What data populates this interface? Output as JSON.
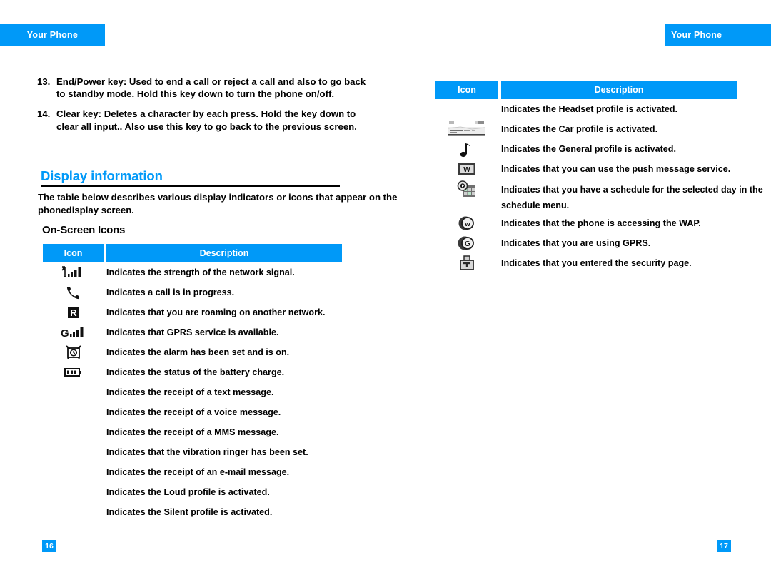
{
  "banners": {
    "left_label": "Your Phone",
    "right_label": "Your Phone"
  },
  "accent_color": "#0099F8",
  "left_page": {
    "numbered_list": [
      {
        "marker": "13.",
        "text": "End/Power key: Used to end a call or reject a call and also to go back to standby mode. Hold this key down to turn the phone on/off."
      },
      {
        "marker": "14.",
        "text": "Clear key: Deletes a character by each press. Hold the key down to clear all input.. Also use this key to go back to the previous screen."
      }
    ],
    "section_title": "Display information",
    "intro_part1": "The table below describes various display indicators or icons that appear on the phon",
    "intro_part2": "e",
    "intro_part3": " display screen.",
    "sub_heading": "On-Screen Icons",
    "table": {
      "headers": {
        "icon": "Icon",
        "description": "Description"
      },
      "rows": [
        {
          "icon_name": "signal-strength-icon",
          "description": "Indicates the strength of the network signal."
        },
        {
          "icon_name": "call-in-progress-icon",
          "description": "Indicates a call is in progress."
        },
        {
          "icon_name": "roaming-icon",
          "description": "Indicates that you are roaming on another network."
        },
        {
          "icon_name": "gprs-available-icon",
          "description": "Indicates that GPRS service is available."
        },
        {
          "icon_name": "alarm-clock-icon",
          "description": "Indicates the alarm has been set and is on."
        },
        {
          "icon_name": "battery-icon",
          "description": "Indicates the status of the battery charge."
        },
        {
          "icon_name": "text-message-icon",
          "description": "Indicates the receipt of a text message."
        },
        {
          "icon_name": "voice-message-icon",
          "description": "Indicates the receipt of a voice message."
        },
        {
          "icon_name": "mms-message-icon",
          "description": "Indicates the receipt of a MMS message."
        },
        {
          "icon_name": "vibration-ringer-icon",
          "description": "Indicates that the vibration ringer has been set."
        },
        {
          "icon_name": "email-message-icon",
          "description": "Indicates the receipt of an e-mail message."
        },
        {
          "icon_name": "loud-profile-icon",
          "description": "Indicates the Loud profile is activated."
        },
        {
          "icon_name": "silent-profile-icon",
          "description": "Indicates the Silent profile is activated."
        }
      ]
    },
    "page_number": "16"
  },
  "right_page": {
    "table": {
      "headers": {
        "icon": "Icon",
        "description": "Description"
      },
      "rows": [
        {
          "icon_name": "headset-profile-icon",
          "description": "Indicates the Headset profile is activated."
        },
        {
          "icon_name": "car-profile-icon",
          "description": "Indicates the Car profile is activated."
        },
        {
          "icon_name": "general-profile-icon",
          "description": "Indicates the General profile is activated."
        },
        {
          "icon_name": "push-message-icon",
          "description": "Indicates that you can use the push message service."
        },
        {
          "icon_name": "schedule-icon",
          "description": "Indicates that you have a schedule for the selected day in the schedule menu."
        },
        {
          "icon_name": "wap-icon",
          "description": "Indicates that the phone is accessing the WAP."
        },
        {
          "icon_name": "gprs-in-use-icon",
          "description": "Indicates that you are using GPRS."
        },
        {
          "icon_name": "security-page-icon",
          "description": "Indicates that you entered the security page."
        }
      ]
    },
    "page_number": "17"
  }
}
